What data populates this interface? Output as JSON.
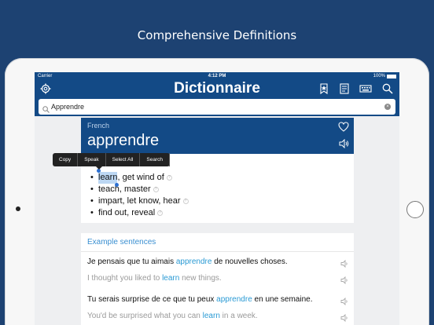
{
  "promo": {
    "title": "Comprehensive Definitions"
  },
  "status": {
    "carrier": "Carrier",
    "time": "4:12 PM",
    "battery": "100%"
  },
  "app": {
    "title": "Dictionnaire"
  },
  "search": {
    "value": "Apprendre"
  },
  "entry": {
    "language": "French",
    "headword": "apprendre",
    "definitions": [
      {
        "selected": "learn",
        "rest": ", get wind of"
      },
      {
        "text": "teach, master"
      },
      {
        "text": "impart, let know, hear"
      },
      {
        "text": "find out, reveal"
      }
    ]
  },
  "context_menu": {
    "items": [
      "Copy",
      "Speak",
      "Select All",
      "Search"
    ]
  },
  "examples": {
    "title": "Example sentences",
    "items": [
      {
        "fr_before": "Je pensais que tu aimais ",
        "fr_hl": "apprendre",
        "fr_after": " de nouvelles choses.",
        "en_before": "I thought you liked to ",
        "en_hl": "learn",
        "en_after": " new things."
      },
      {
        "fr_before": "Tu serais surprise de ce que tu peux ",
        "fr_hl": "apprendre",
        "fr_after": " en une semaine.",
        "en_before": "You'd be surprised what you can ",
        "en_hl": "learn",
        "en_after": " in a week."
      }
    ]
  },
  "colors": {
    "brand": "#134a86",
    "background": "#1d4272",
    "highlight": "#2a9ad4",
    "selection": "#bcd7f3"
  },
  "icons": {
    "settings": "gear-icon",
    "bookmarks": "bookmark-star-icon",
    "flashcards": "flashcard-icon",
    "keyboard": "keyboard-icon",
    "search": "search-icon",
    "clear": "clear-icon",
    "favorite": "heart-icon",
    "audio": "speaker-icon",
    "info": "info-icon"
  }
}
